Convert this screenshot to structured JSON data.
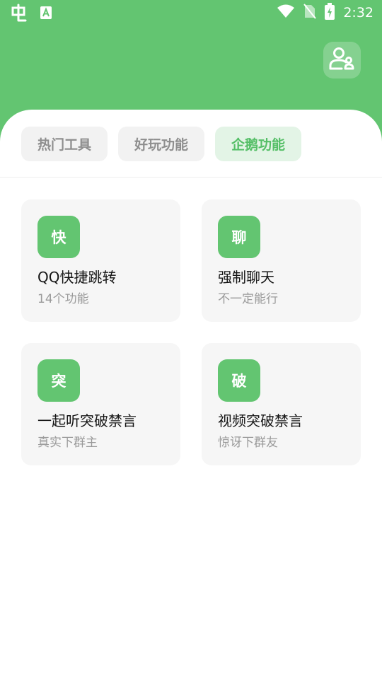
{
  "status_bar": {
    "time": "2:32",
    "left_icons": [
      "app-logo-icon",
      "translate-a-icon"
    ],
    "right_icons": [
      "wifi-icon",
      "no-sim-icon",
      "battery-charging-icon"
    ]
  },
  "colors": {
    "primary": "#63c571",
    "active_tab_bg": "#e3f4e6",
    "active_tab_text": "#55bf67",
    "card_bg": "#f6f6f6"
  },
  "header": {
    "profile_icon": "users-icon"
  },
  "tabs": [
    {
      "label": "热门工具",
      "active": false
    },
    {
      "label": "好玩功能",
      "active": false
    },
    {
      "label": "企鹅功能",
      "active": true
    }
  ],
  "tools": [
    {
      "badge": "快",
      "title": "QQ快捷跳转",
      "subtitle": "14个功能"
    },
    {
      "badge": "聊",
      "title": "强制聊天",
      "subtitle": "不一定能行"
    },
    {
      "badge": "突",
      "title": "一起听突破禁言",
      "subtitle": "真实下群主"
    },
    {
      "badge": "破",
      "title": "视频突破禁言",
      "subtitle": "惊讶下群友"
    }
  ]
}
